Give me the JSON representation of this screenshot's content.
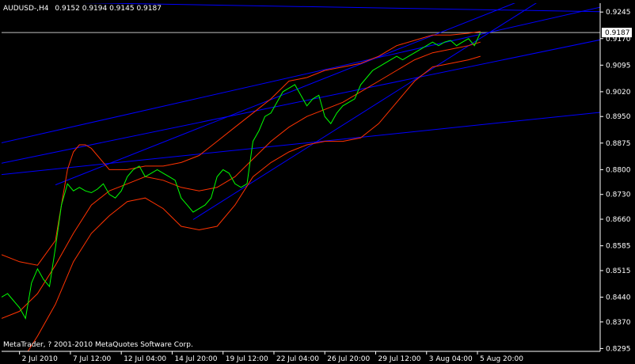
{
  "header": {
    "symbol": "AUDUSD-,H4",
    "ohlc": "0.9152 0.9194 0.9145 0.9187"
  },
  "footer": {
    "copyright": "MetaTrader, ? 2001-2010 MetaQuotes Software Corp."
  },
  "current_price": {
    "label": "0.9187",
    "value": 0.9187
  },
  "colors": {
    "background": "#000000",
    "price_line": "#00ff00",
    "bands": "#ff3300",
    "trendlines": "#0000ff",
    "axis": "#ffffff",
    "text": "#ffffff",
    "price_tag_bg": "#ffffff",
    "price_tag_text": "#000000"
  },
  "chart_data": {
    "type": "line",
    "title": "",
    "ylim": [
      0.8287,
      0.927
    ],
    "xlim": [
      0,
      100
    ],
    "y_ticks": [
      "0.9245",
      "0.9170",
      "0.9095",
      "0.9020",
      "0.8950",
      "0.8875",
      "0.8800",
      "0.8730",
      "0.8660",
      "0.8585",
      "0.8515",
      "0.8440",
      "0.8370",
      "0.8295"
    ],
    "x_ticks": [
      {
        "label": "2 Jul 2010",
        "x": 3
      },
      {
        "label": "7 Jul 12:00",
        "x": 11.5
      },
      {
        "label": "12 Jul 04:00",
        "x": 20
      },
      {
        "label": "14 Jul 20:00",
        "x": 28.5
      },
      {
        "label": "19 Jul 12:00",
        "x": 37
      },
      {
        "label": "22 Jul 04:00",
        "x": 45.5
      },
      {
        "label": "26 Jul 20:00",
        "x": 54
      },
      {
        "label": "29 Jul 12:00",
        "x": 62.5
      },
      {
        "label": "3 Aug 04:00",
        "x": 71
      },
      {
        "label": "5 Aug 20:00",
        "x": 79.5
      }
    ],
    "series": [
      {
        "key": "price",
        "x": [
          0,
          1,
          2,
          3,
          4,
          5,
          6,
          7,
          8,
          9,
          10,
          11,
          12,
          13,
          14,
          15,
          16,
          17,
          18,
          19,
          20,
          21,
          22,
          23,
          24,
          25,
          26,
          27,
          28,
          29,
          30,
          31,
          32,
          33,
          34,
          35,
          36,
          37,
          38,
          39,
          40,
          41,
          42,
          43,
          44,
          45,
          46,
          47,
          48,
          49,
          50,
          51,
          52,
          53,
          54,
          55,
          56,
          57,
          58,
          59,
          60,
          61,
          62,
          63,
          64,
          65,
          66,
          67,
          68,
          69,
          70,
          71,
          72,
          73,
          74,
          75,
          76,
          77,
          78,
          79,
          80
        ],
        "y": [
          0.844,
          0.845,
          0.843,
          0.841,
          0.838,
          0.848,
          0.852,
          0.849,
          0.847,
          0.858,
          0.87,
          0.876,
          0.874,
          0.875,
          0.874,
          0.8735,
          0.8745,
          0.876,
          0.873,
          0.872,
          0.874,
          0.878,
          0.88,
          0.881,
          0.878,
          0.879,
          0.88,
          0.879,
          0.878,
          0.877,
          0.872,
          0.87,
          0.868,
          0.869,
          0.87,
          0.872,
          0.878,
          0.88,
          0.879,
          0.876,
          0.875,
          0.876,
          0.888,
          0.891,
          0.895,
          0.896,
          0.899,
          0.902,
          0.903,
          0.904,
          0.901,
          0.898,
          0.9,
          0.901,
          0.895,
          0.893,
          0.896,
          0.898,
          0.899,
          0.9,
          0.904,
          0.906,
          0.908,
          0.909,
          0.91,
          0.911,
          0.912,
          0.911,
          0.912,
          0.913,
          0.914,
          0.915,
          0.916,
          0.915,
          0.916,
          0.9165,
          0.915,
          0.916,
          0.917,
          0.915,
          0.9187
        ]
      },
      {
        "key": "band-upper",
        "x": [
          0,
          3,
          6,
          9,
          10,
          11,
          12,
          13,
          14,
          15,
          18,
          21,
          24,
          27,
          30,
          33,
          36,
          39,
          42,
          45,
          48,
          51,
          54,
          57,
          60,
          63,
          66,
          69,
          72,
          75,
          78,
          80
        ],
        "y": [
          0.856,
          0.854,
          0.853,
          0.86,
          0.87,
          0.88,
          0.885,
          0.887,
          0.887,
          0.886,
          0.88,
          0.88,
          0.881,
          0.881,
          0.882,
          0.884,
          0.888,
          0.892,
          0.896,
          0.9,
          0.905,
          0.906,
          0.908,
          0.909,
          0.91,
          0.912,
          0.915,
          0.9165,
          0.918,
          0.918,
          0.9185,
          0.919
        ]
      },
      {
        "key": "band-middle",
        "x": [
          0,
          3,
          6,
          9,
          12,
          15,
          18,
          21,
          24,
          27,
          30,
          33,
          36,
          39,
          42,
          45,
          48,
          51,
          54,
          57,
          60,
          63,
          66,
          69,
          72,
          75,
          78,
          80
        ],
        "y": [
          0.838,
          0.84,
          0.845,
          0.853,
          0.862,
          0.87,
          0.874,
          0.876,
          0.878,
          0.877,
          0.875,
          0.874,
          0.875,
          0.878,
          0.883,
          0.888,
          0.892,
          0.895,
          0.897,
          0.899,
          0.902,
          0.905,
          0.908,
          0.911,
          0.913,
          0.914,
          0.915,
          0.916
        ]
      },
      {
        "key": "band-lower",
        "x": [
          0,
          3,
          6,
          9,
          12,
          15,
          18,
          21,
          24,
          27,
          30,
          33,
          36,
          39,
          42,
          45,
          48,
          51,
          54,
          57,
          60,
          63,
          66,
          69,
          72,
          75,
          78,
          80
        ],
        "y": [
          0.82,
          0.825,
          0.833,
          0.842,
          0.854,
          0.862,
          0.867,
          0.871,
          0.872,
          0.869,
          0.864,
          0.863,
          0.864,
          0.87,
          0.878,
          0.882,
          0.885,
          0.887,
          0.888,
          0.888,
          0.889,
          0.893,
          0.899,
          0.905,
          0.909,
          0.91,
          0.911,
          0.912
        ]
      },
      {
        "key": "trendline",
        "lines": [
          {
            "x1": -2,
            "y1": 0.8868,
            "x2": 103,
            "y2": 0.927
          },
          {
            "x1": 0,
            "y1": 0.8818,
            "x2": 103,
            "y2": 0.9177
          },
          {
            "x1": 0,
            "y1": 0.8786,
            "x2": 103,
            "y2": 0.8967
          },
          {
            "x1": 9,
            "y1": 0.8757,
            "x2": 90,
            "y2": 0.9299
          },
          {
            "x1": 32,
            "y1": 0.8659,
            "x2": 92,
            "y2": 0.9299
          },
          {
            "x1": 0,
            "y1": 0.9275,
            "x2": 103,
            "y2": 0.9245
          }
        ]
      }
    ]
  }
}
